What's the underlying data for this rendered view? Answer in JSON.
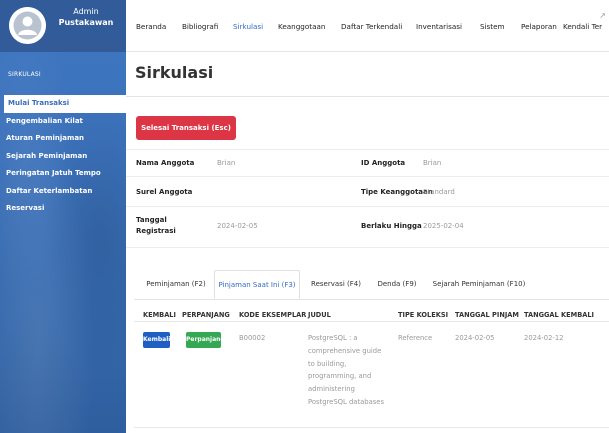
{
  "colors": {
    "sidebar": "#3a6fb8",
    "accent": "#2f6cc0",
    "danger": "#dc3545",
    "button_blue": "#1f5fc4",
    "button_green": "#35a853"
  },
  "sidebar": {
    "profile": {
      "name": "Admin",
      "role": "Pustakawan"
    },
    "section_label": "SIRKULASI",
    "items": [
      {
        "label": "Mulai Transaksi",
        "active": true
      },
      {
        "label": "Pengembalian Kilat"
      },
      {
        "label": "Aturan Peminjaman"
      },
      {
        "label": "Sejarah Peminjaman"
      },
      {
        "label": "Peringatan Jatuh Tempo"
      },
      {
        "label": "Daftar Keterlambatan"
      },
      {
        "label": "Reservasi"
      }
    ]
  },
  "topnav": {
    "items": [
      {
        "label": "Beranda"
      },
      {
        "label": "Bibliografi"
      },
      {
        "label": "Sirkulasi",
        "active": true
      },
      {
        "label": "Keanggotaan"
      },
      {
        "label": "Daftar Terkendali"
      },
      {
        "label": "Inventarisasi"
      },
      {
        "label": "Sistem"
      },
      {
        "label": "Pelaporan"
      },
      {
        "label": "Kendali Ter"
      }
    ],
    "corner_icon": "expand-icon"
  },
  "main": {
    "title": "Sirkulasi",
    "end_transaction_button": "Selesai Transaksi (Esc)",
    "member_info": {
      "nama_label": "Nama Anggota",
      "nama_value": "Brian",
      "id_label": "ID Anggota",
      "id_value": "Brian",
      "surel_label": "Surel Anggota",
      "surel_value": "",
      "tipe_label": "Tipe Keanggotaan",
      "tipe_value": "Standard",
      "reg_label_1": "Tanggal",
      "reg_label_2": "Registrasi",
      "reg_value": "2024-02-05",
      "berlaku_label": "Berlaku Hingga",
      "berlaku_value": "2025-02-04"
    },
    "tabs": [
      {
        "label": "Peminjaman (F2)"
      },
      {
        "label": "Pinjaman Saat Ini (F3)",
        "active": true
      },
      {
        "label": "Reservasi (F4)"
      },
      {
        "label": "Denda (F9)"
      },
      {
        "label": "Sejarah Peminjaman (F10)"
      }
    ],
    "table": {
      "headers": [
        "KEMBALI",
        "PERPANJANG",
        "KODE EKSEMPLAR",
        "JUDUL",
        "TIPE KOLEKSI",
        "TANGGAL PINJAM",
        "TANGGAL KEMBALI"
      ],
      "rows": [
        {
          "return_button": "Kembali",
          "extend_button": "Perpanjang",
          "item_code": "B00002",
          "title_lines": [
            "PostgreSQL : a",
            "comprehensive guide",
            "to building,",
            "programming, and",
            "administering",
            "PostgreSQL databases"
          ],
          "collection_type": "Reference",
          "loan_date": "2024-02-05",
          "due_date": "2024-02-12"
        }
      ]
    }
  }
}
